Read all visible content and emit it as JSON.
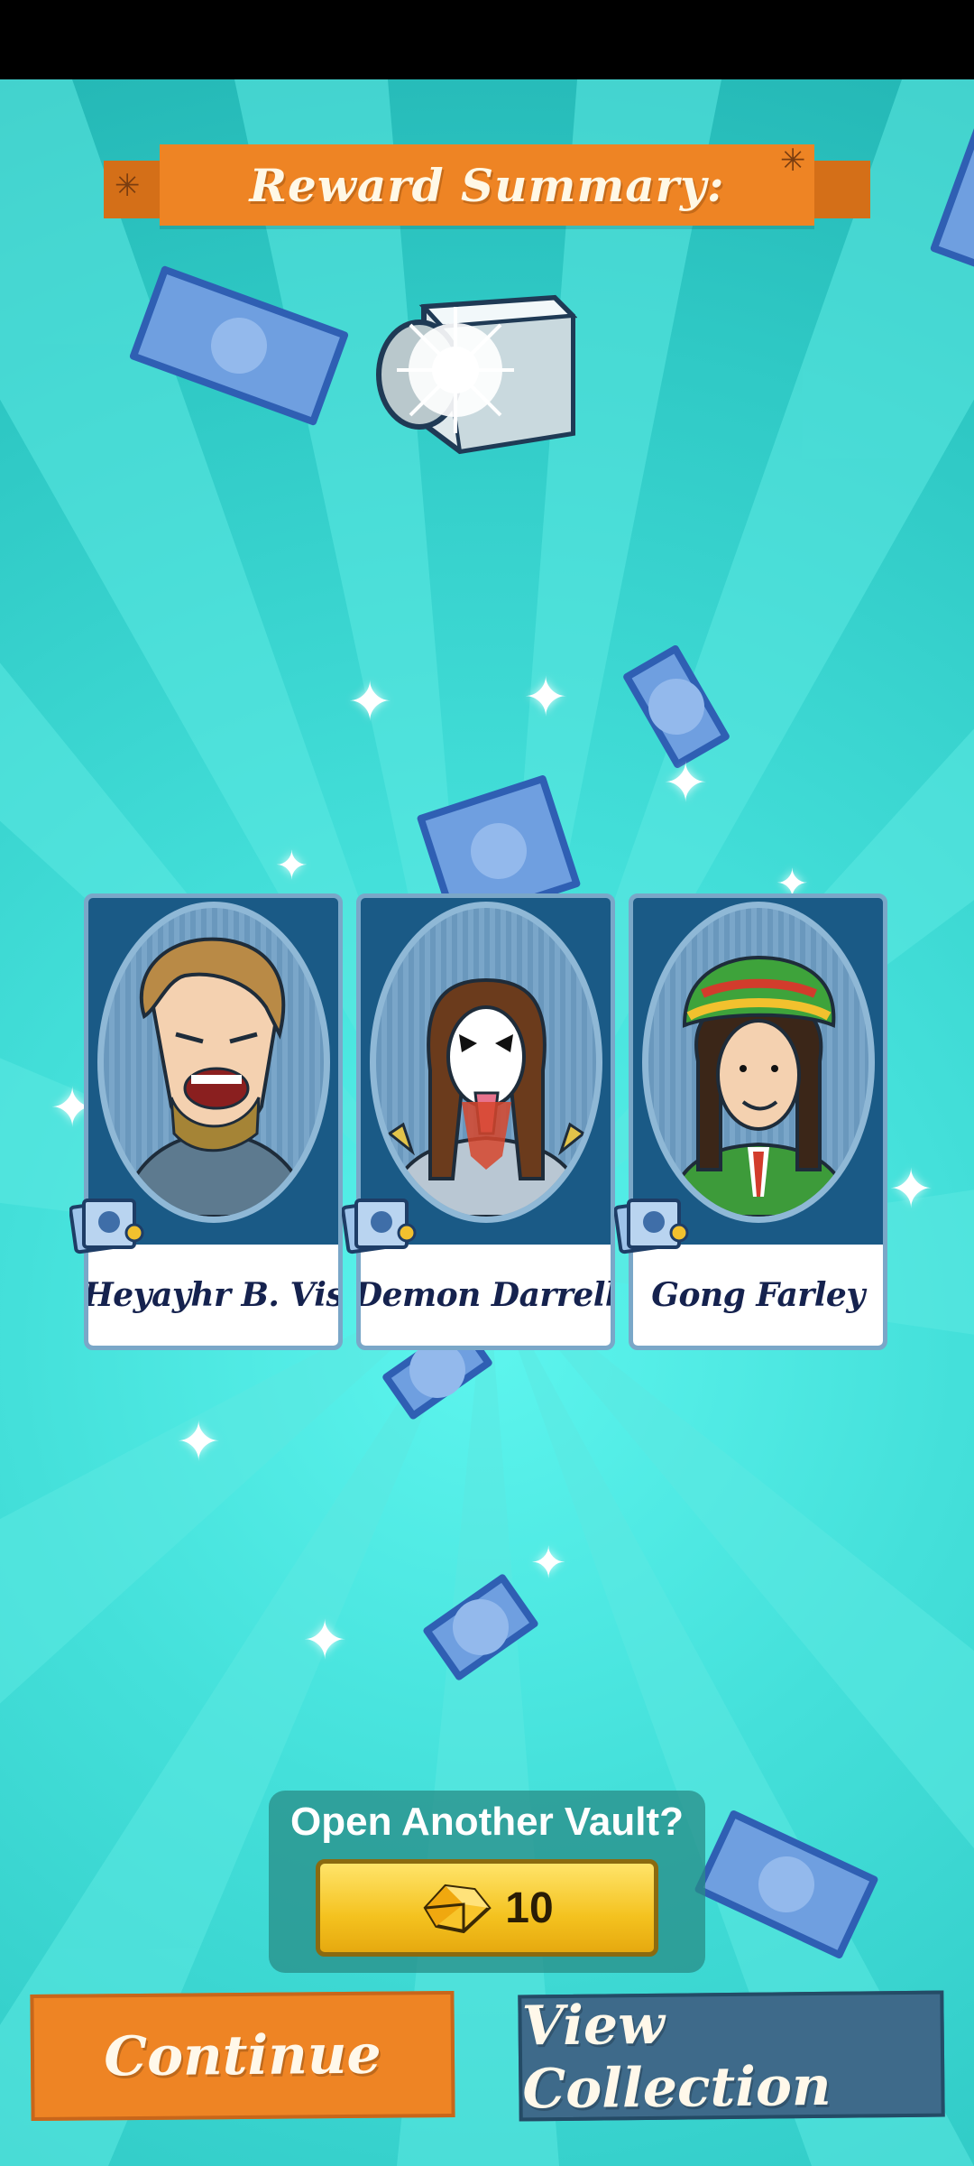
{
  "header": {
    "title": "Reward Summary:"
  },
  "vault": {
    "icon": "diamond-vault-icon"
  },
  "cards": [
    {
      "name": "Heyayhr B. Vis",
      "badge_icon": "card-stack-icon"
    },
    {
      "name": "Demon Darrell",
      "badge_icon": "card-stack-icon"
    },
    {
      "name": "Gong Farley",
      "badge_icon": "card-stack-icon"
    }
  ],
  "reopen": {
    "title": "Open Another Vault?",
    "cost": "10",
    "currency_icon": "gem-icon"
  },
  "buttons": {
    "continue": "Continue",
    "view_collection": "View Collection"
  },
  "colors": {
    "background": "#34d2cd",
    "orange": "#ee8424",
    "blue": "#3e6a8a",
    "gold": "#f4c21f"
  }
}
